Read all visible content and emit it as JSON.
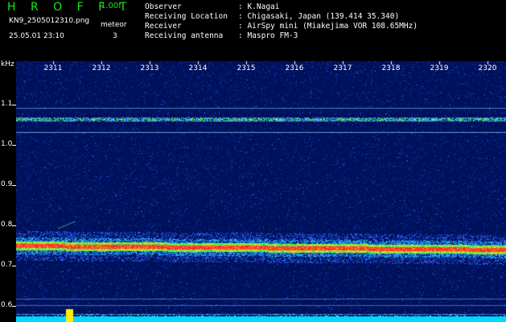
{
  "header": {
    "title": "H R O F F T",
    "version": "1.00f",
    "filename": "KN9_2505012310.png",
    "meteor_label": "meteor",
    "meteor_count": "3",
    "datetime": "25.05.01 23:10",
    "info": [
      {
        "key": "Observer",
        "value": ": K.Nagai"
      },
      {
        "key": "Receiving Location",
        "value": ": Chigasaki, Japan (139.414 35.340)"
      },
      {
        "key": "Receiver",
        "value": ": AirSpy mini (Miakejima VOR 108.65MHz)"
      },
      {
        "key": "Receiving antenna",
        "value": ": Maspro FM-3"
      }
    ]
  },
  "spectrogram": {
    "y_unit": "kHz",
    "y_ticks": [
      "1.1",
      "1.0",
      "0.9",
      "0.8",
      "0.7",
      "0.6"
    ],
    "x_ticks": [
      "2311",
      "2312",
      "2313",
      "2314",
      "2315",
      "2316",
      "2317",
      "2318",
      "2319",
      "2320"
    ],
    "colors": {
      "background": "#00115c",
      "noise": "#1a3dc8",
      "signal": "#ff2020",
      "band": "#20e060",
      "baseline": "#00d8ff"
    }
  }
}
